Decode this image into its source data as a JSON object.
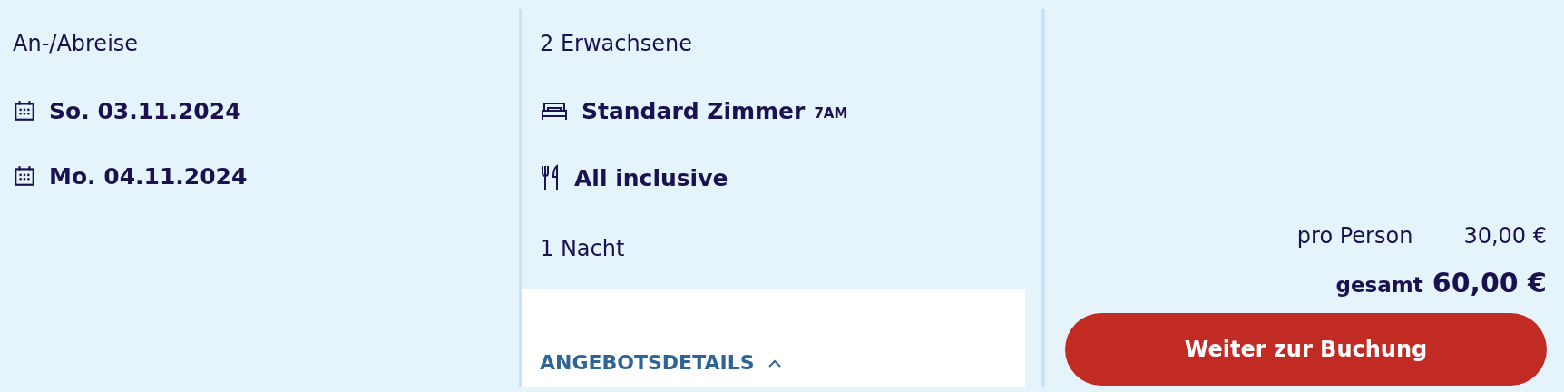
{
  "travel_dates": {
    "label": "An-/Abreise",
    "dates": [
      {
        "text": "So. 03.11.2024"
      },
      {
        "text": "Mo. 04.11.2024"
      }
    ]
  },
  "offer": {
    "guests": "2 Erwachsene",
    "room": {
      "name": "Standard Zimmer",
      "code": "7AM"
    },
    "board": "All inclusive",
    "nights": "1 Nacht",
    "details_toggle": {
      "label": "ANGEBOTSDETAILS",
      "expanded": true
    }
  },
  "price": {
    "per_person_label": "pro Person",
    "per_person_value": "30,00 €",
    "total_label": "gesamt",
    "total_value": "60,00 €",
    "button": "Weiter zur Buchung"
  }
}
